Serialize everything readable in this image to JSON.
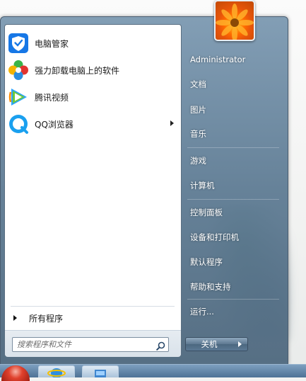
{
  "programs": [
    {
      "label": "电脑管家",
      "icon": "tencent-pc-manager-icon"
    },
    {
      "label": "强力卸载电脑上的软件",
      "icon": "uninstaller-icon"
    },
    {
      "label": "腾讯视频",
      "icon": "tencent-video-icon"
    },
    {
      "label": "QQ浏览器",
      "icon": "qq-browser-icon",
      "has_submenu": true
    }
  ],
  "all_programs_label": "所有程序",
  "search": {
    "placeholder": "搜索程序和文件"
  },
  "right_menu": {
    "username": "Administrator",
    "items": [
      "文档",
      "图片",
      "音乐",
      "游戏",
      "计算机",
      "控制面板",
      "设备和打印机",
      "默认程序",
      "帮助和支持",
      "运行..."
    ]
  },
  "shutdown": {
    "label": "关机"
  },
  "colors": {
    "menu_glass": "#5f7f9c",
    "left_pane": "#ffffff",
    "right_text": "#ffffff"
  }
}
